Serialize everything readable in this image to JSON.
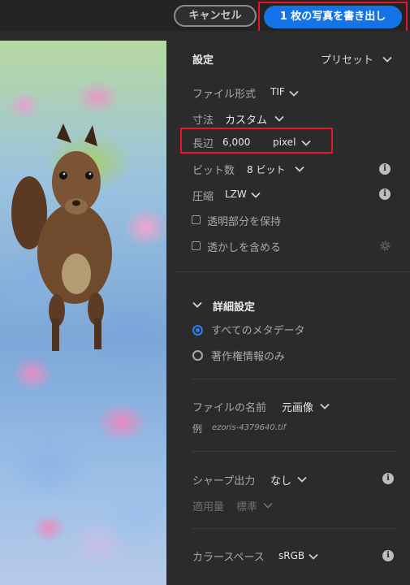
{
  "topbar": {
    "cancel_label": "キャンセル",
    "export_label": "1 枚の写真を書き出し"
  },
  "settings": {
    "title": "設定",
    "preset_label": "プリセット",
    "file_format_label": "ファイル形式",
    "file_format_value": "TIF",
    "dimensions_label": "寸法",
    "dimensions_value": "カスタム",
    "long_edge_label": "長辺",
    "long_edge_value": "6,000",
    "unit_value": "pixel",
    "bit_depth_label": "ビット数",
    "bit_depth_value": "8 ビット",
    "compression_label": "圧縮",
    "compression_value": "LZW",
    "keep_transparency_label": "透明部分を保持",
    "include_watermark_label": "透かしを含める"
  },
  "advanced": {
    "title": "詳細設定",
    "metadata_all_label": "すべてのメタデータ",
    "metadata_copyright_label": "著作権情報のみ",
    "file_name_label": "ファイルの名前",
    "file_name_value": "元画像",
    "example_label": "例",
    "example_value": "ezoris-4379640.tif",
    "sharpen_label": "シャープ出力",
    "sharpen_value": "なし",
    "amount_label": "適用量",
    "amount_value": "標準",
    "color_space_label": "カラースペース",
    "color_space_value": "sRGB"
  },
  "colors": {
    "accent": "#1473e6",
    "highlight": "#e8152a",
    "panel_bg": "#2b2b2b"
  }
}
